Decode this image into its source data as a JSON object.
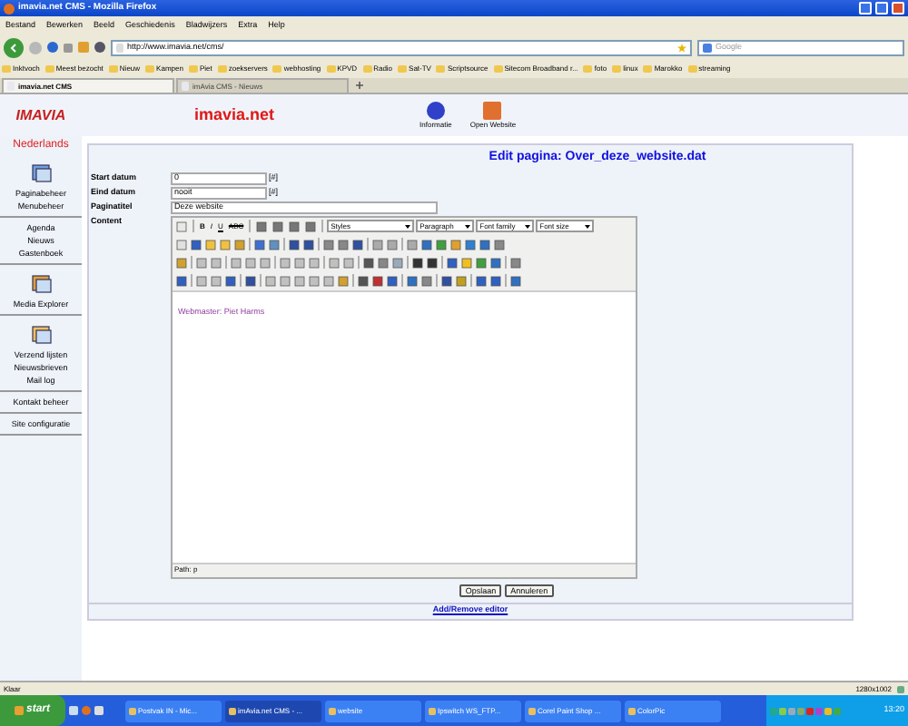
{
  "window": {
    "title": "imavia.net CMS - Mozilla Firefox"
  },
  "menu": [
    "Bestand",
    "Bewerken",
    "Beeld",
    "Geschiedenis",
    "Bladwijzers",
    "Extra",
    "Help"
  ],
  "address": {
    "value": "http://www.imavia.net/cms/"
  },
  "search": {
    "placeholder": "Google"
  },
  "bookmarks": [
    "Inktvoch",
    "Meest bezocht",
    "Nieuw",
    "Kampen",
    "Piet",
    "zoekservers",
    "webhosting",
    "KPVD",
    "Radio",
    "Sat-TV",
    "Scriptsource",
    "Sitecom Broadband r...",
    "foto",
    "linux",
    "Marokko",
    "streaming"
  ],
  "tabs": [
    {
      "label": "imavia.net CMS",
      "selected": true
    },
    {
      "label": "imAvia CMS - Nieuws",
      "selected": false
    }
  ],
  "header": {
    "logo": "IMAVIA",
    "site": "imavia.net",
    "actions": [
      "Informatie",
      "Open Website"
    ]
  },
  "sidebar": {
    "language": "Nederlands",
    "groups": [
      {
        "items": [
          "Paginabeheer",
          "Menubeheer"
        ]
      },
      {
        "items": [
          "Agenda",
          "Nieuws",
          "Gastenboek"
        ]
      },
      {
        "items": [
          "Media Explorer"
        ]
      },
      {
        "items": [
          "Verzend lijsten",
          "Nieuwsbrieven",
          "Mail log"
        ]
      },
      {
        "items": [
          "Kontakt beheer"
        ]
      },
      {
        "items": [
          "Site configuratie"
        ]
      }
    ]
  },
  "form": {
    "title": "Edit pagina: Over_deze_website.dat",
    "fields": [
      {
        "label": "Start datum",
        "value": "0",
        "button": "[#]"
      },
      {
        "label": "Eind datum",
        "value": "nooit",
        "button": "[#]"
      },
      {
        "label": "Paginatitel",
        "value": "Deze website"
      }
    ],
    "content_label": "Content",
    "text_buttons": [
      "B",
      "I",
      "U",
      "ABC"
    ],
    "dropdowns": [
      "Styles",
      "Paragraph",
      "Font family",
      "Font size"
    ],
    "content": "Webmaster: Piet Harms",
    "path": "Path: p",
    "buttons": [
      "Opslaan",
      "Annuleren"
    ],
    "footer_link": "Add/Remove editor"
  },
  "status_bar": {
    "text": "Klaar",
    "resolution": "1280x1002"
  },
  "taskbar": {
    "start": "start",
    "tasks": [
      {
        "label": "Postvak IN - Mic...",
        "selected": false
      },
      {
        "label": "imAvia.net CMS - ...",
        "selected": true
      },
      {
        "label": "website",
        "selected": false
      },
      {
        "label": "Ipswitch WS_FTP...",
        "selected": false
      },
      {
        "label": "Corel Paint Shop ...",
        "selected": false
      },
      {
        "label": "ColorPic",
        "selected": false
      }
    ],
    "clock": "13:20"
  }
}
